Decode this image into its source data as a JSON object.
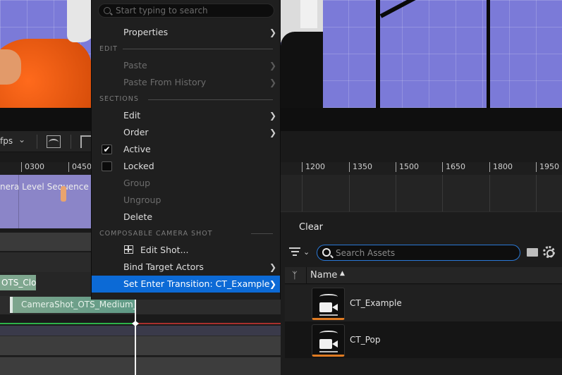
{
  "context_menu": {
    "search_placeholder": "Start typing to search",
    "properties": "Properties",
    "section_edit": "EDIT",
    "paste": "Paste",
    "paste_from_history": "Paste From History",
    "section_sections": "SECTIONS",
    "edit": "Edit",
    "order": "Order",
    "active": "Active",
    "active_checked": true,
    "locked": "Locked",
    "locked_checked": false,
    "group": "Group",
    "ungroup": "Ungroup",
    "delete": "Delete",
    "section_composable": "COMPOSABLE CAMERA SHOT",
    "edit_shot": "Edit Shot...",
    "bind_target_actors": "Bind Target Actors",
    "set_enter_transition": "Set Enter Transition: CT_Example"
  },
  "sequencer": {
    "fps_label": "fps",
    "ruler_left": [
      "0300",
      "0450"
    ],
    "ruler_right": [
      "1200",
      "1350",
      "1500",
      "1650",
      "1800",
      "1950"
    ],
    "track_thumbnail_text": "nera Level Sequence S",
    "clip_close": "OTS_Close",
    "clip_medium": "CameraShot_OTS_Medium_l"
  },
  "content_browser": {
    "clear_label": "Clear",
    "search_placeholder": "Search Assets",
    "column_name": "Name",
    "sort_glyph": "▲",
    "assets": [
      {
        "name": "CT_Example",
        "icon": "camera-transition-icon"
      },
      {
        "name": "CT_Pop",
        "icon": "camera-transition-icon"
      }
    ]
  },
  "colors": {
    "selected_menu": "#0c6ad6",
    "search_focus_border": "#2b79d6",
    "asset_accent": "#e07b22",
    "clip_green": "#7fa78f",
    "playhead": "#f2f2f2"
  }
}
